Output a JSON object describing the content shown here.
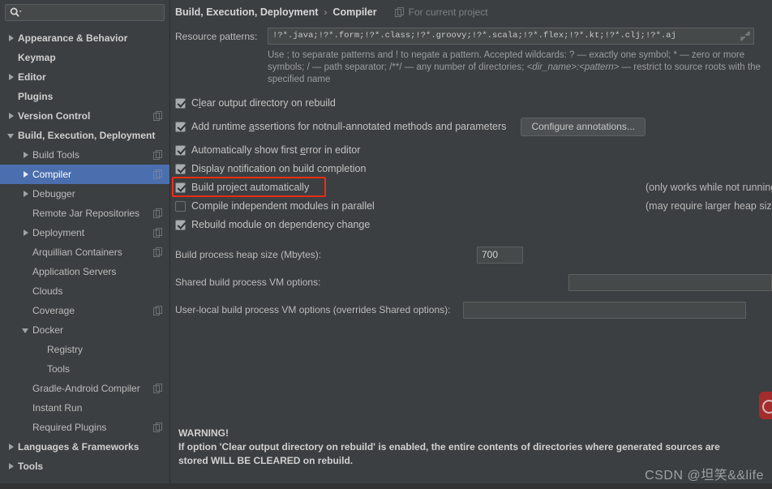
{
  "window": {
    "bg_color": "#3c3f41",
    "accent_selection": "#4b6eaf",
    "highlight_box_color": "#ee2b19"
  },
  "sidebar": {
    "search": {
      "placeholder": "",
      "value": "",
      "icon": "search-icon"
    },
    "items": [
      {
        "label": "Appearance & Behavior",
        "arrow": "right",
        "indent": 0,
        "bold": true,
        "copy": false,
        "selected": false
      },
      {
        "label": "Keymap",
        "arrow": "none",
        "indent": 0,
        "bold": true,
        "copy": false,
        "selected": false
      },
      {
        "label": "Editor",
        "arrow": "right",
        "indent": 0,
        "bold": true,
        "copy": false,
        "selected": false
      },
      {
        "label": "Plugins",
        "arrow": "none",
        "indent": 0,
        "bold": true,
        "copy": false,
        "selected": false
      },
      {
        "label": "Version Control",
        "arrow": "right",
        "indent": 0,
        "bold": true,
        "copy": true,
        "selected": false
      },
      {
        "label": "Build, Execution, Deployment",
        "arrow": "down",
        "indent": 0,
        "bold": true,
        "copy": false,
        "selected": false
      },
      {
        "label": "Build Tools",
        "arrow": "right",
        "indent": 1,
        "bold": false,
        "copy": true,
        "selected": false
      },
      {
        "label": "Compiler",
        "arrow": "right",
        "indent": 1,
        "bold": false,
        "copy": true,
        "selected": true
      },
      {
        "label": "Debugger",
        "arrow": "right",
        "indent": 1,
        "bold": false,
        "copy": false,
        "selected": false
      },
      {
        "label": "Remote Jar Repositories",
        "arrow": "none",
        "indent": 1,
        "bold": false,
        "copy": true,
        "selected": false
      },
      {
        "label": "Deployment",
        "arrow": "right",
        "indent": 1,
        "bold": false,
        "copy": true,
        "selected": false
      },
      {
        "label": "Arquillian Containers",
        "arrow": "none",
        "indent": 1,
        "bold": false,
        "copy": true,
        "selected": false
      },
      {
        "label": "Application Servers",
        "arrow": "none",
        "indent": 1,
        "bold": false,
        "copy": false,
        "selected": false
      },
      {
        "label": "Clouds",
        "arrow": "none",
        "indent": 1,
        "bold": false,
        "copy": false,
        "selected": false
      },
      {
        "label": "Coverage",
        "arrow": "none",
        "indent": 1,
        "bold": false,
        "copy": true,
        "selected": false
      },
      {
        "label": "Docker",
        "arrow": "down",
        "indent": 1,
        "bold": false,
        "copy": false,
        "selected": false
      },
      {
        "label": "Registry",
        "arrow": "none",
        "indent": 2,
        "bold": false,
        "copy": false,
        "selected": false
      },
      {
        "label": "Tools",
        "arrow": "none",
        "indent": 2,
        "bold": false,
        "copy": false,
        "selected": false
      },
      {
        "label": "Gradle-Android Compiler",
        "arrow": "none",
        "indent": 1,
        "bold": false,
        "copy": true,
        "selected": false
      },
      {
        "label": "Instant Run",
        "arrow": "none",
        "indent": 1,
        "bold": false,
        "copy": false,
        "selected": false
      },
      {
        "label": "Required Plugins",
        "arrow": "none",
        "indent": 1,
        "bold": false,
        "copy": true,
        "selected": false
      },
      {
        "label": "Languages & Frameworks",
        "arrow": "right",
        "indent": 0,
        "bold": true,
        "copy": false,
        "selected": false
      },
      {
        "label": "Tools",
        "arrow": "right",
        "indent": 0,
        "bold": true,
        "copy": false,
        "selected": false
      }
    ]
  },
  "header": {
    "breadcrumb_parent": "Build, Execution, Deployment",
    "breadcrumb_sep": "›",
    "breadcrumb_current": "Compiler",
    "scope_label": "For current project",
    "scope_icon": "copy-scope-icon"
  },
  "resource_patterns": {
    "label": "Resource patterns:",
    "value": "!?*.java;!?*.form;!?*.class;!?*.groovy;!?*.scala;!?*.flex;!?*.kt;!?*.clj;!?*.aj",
    "expand_icon": "expand-field-icon",
    "hint_part1": "Use ; to separate patterns and ! to negate a pattern. Accepted wildcards: ? — exactly one symbol; * — zero or more symbols; / — path separator; /**/ — any number of directories; ",
    "hint_italic": "<dir_name>:<pattern>",
    "hint_part2": " — restrict to source roots with the specified name"
  },
  "options": [
    {
      "name": "clear-output-directory-on-rebuild",
      "label_pre": "C",
      "label_underline": "l",
      "label_post": "ear output directory on rebuild",
      "checked": true,
      "note": "",
      "highlighted": false
    },
    {
      "name": "add-runtime-assertions",
      "label_pre": "Add runtime ",
      "label_underline": "a",
      "label_post": "ssertions for notnull-annotated methods and parameters",
      "checked": true,
      "note": "",
      "highlighted": false,
      "button": "Configure annotations..."
    },
    {
      "name": "automatically-show-first-error",
      "label_pre": "Automatically show first ",
      "label_underline": "e",
      "label_post": "rror in editor",
      "checked": true,
      "note": "",
      "highlighted": false
    },
    {
      "name": "display-notification-on-build-completion",
      "label_pre": "Display notification on build completion",
      "label_underline": "",
      "label_post": "",
      "checked": true,
      "note": "",
      "highlighted": false
    },
    {
      "name": "build-project-automatically",
      "label_pre": "Build project automatically",
      "label_underline": "",
      "label_post": "",
      "checked": true,
      "note": "(only works while not running / debugging)",
      "highlighted": true
    },
    {
      "name": "compile-independent-modules-in-parallel",
      "label_pre": "Compile independent modules in parallel",
      "label_underline": "",
      "label_post": "",
      "checked": false,
      "note": "(may require larger heap size)",
      "highlighted": false
    },
    {
      "name": "rebuild-module-on-dependency-change",
      "label_pre": "Rebuild module on dependency change",
      "label_underline": "",
      "label_post": "",
      "checked": true,
      "note": "",
      "highlighted": false
    }
  ],
  "fields": [
    {
      "name": "build-process-heap-size",
      "label": "Build process heap size (Mbytes):",
      "value": "700",
      "width": "small",
      "placeholder": ""
    },
    {
      "name": "shared-build-process-vm-options",
      "label": "Shared build process VM options:",
      "value": "",
      "width": "wide",
      "placeholder": ""
    },
    {
      "name": "user-local-build-process-vm-options",
      "label": "User-local build process VM options (overrides Shared options):",
      "value": "",
      "width": "wide",
      "placeholder": ""
    }
  ],
  "warning": {
    "title": "WARNING!",
    "line1": "If option 'Clear output directory on rebuild' is enabled, the entire contents of directories where generated sources are",
    "line2": "stored WILL BE CLEARED on rebuild."
  },
  "watermark": {
    "text": "CSDN @坦笑&&life"
  }
}
